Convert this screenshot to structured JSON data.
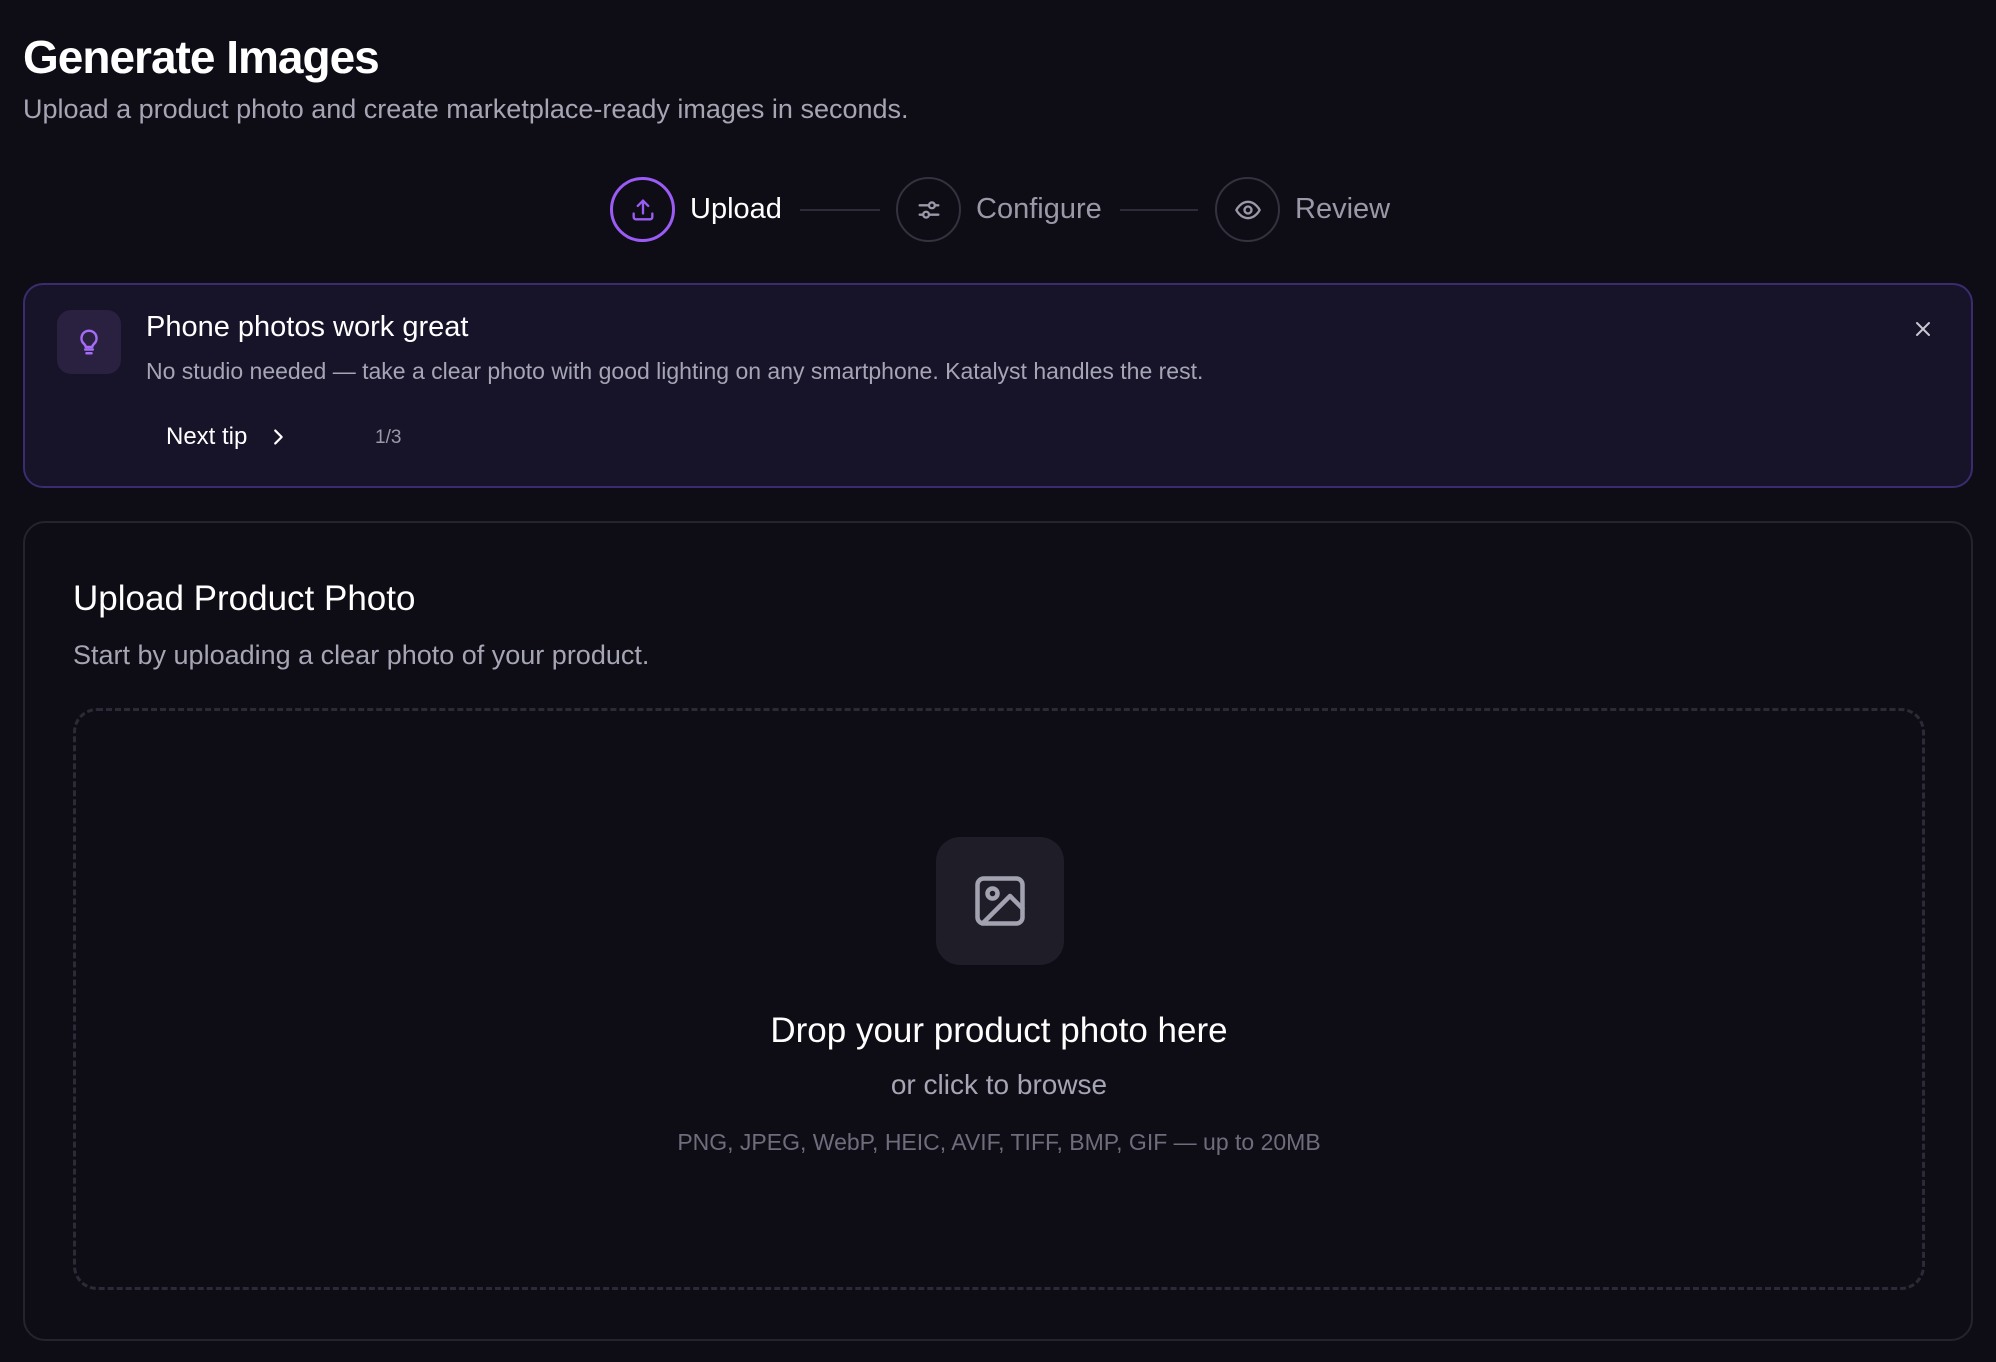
{
  "header": {
    "title": "Generate Images",
    "subtitle": "Upload a product photo and create marketplace-ready images in seconds."
  },
  "stepper": {
    "steps": [
      {
        "label": "Upload",
        "icon": "upload-icon",
        "active": true
      },
      {
        "label": "Configure",
        "icon": "sliders-icon",
        "active": false
      },
      {
        "label": "Review",
        "icon": "eye-icon",
        "active": false
      }
    ]
  },
  "tip": {
    "icon": "lightbulb-icon",
    "title": "Phone photos work great",
    "body": "No studio needed — take a clear photo with good lighting on any smartphone. Katalyst handles the rest.",
    "next_label": "Next tip",
    "counter": "1/3",
    "close_icon": "close-icon"
  },
  "upload": {
    "title": "Upload Product Photo",
    "subtitle": "Start by uploading a clear photo of your product.",
    "dropzone": {
      "icon": "image-icon",
      "title": "Drop your product photo here",
      "subtitle": "or click to browse",
      "formats": "PNG, JPEG, WebP, HEIC, AVIF, TIFF, BMP, GIF — up to 20MB"
    }
  },
  "colors": {
    "background": "#0e0d15",
    "accent": "#9b5cf6",
    "tip_background": "#17142a",
    "tip_border": "#3a2c6e"
  }
}
